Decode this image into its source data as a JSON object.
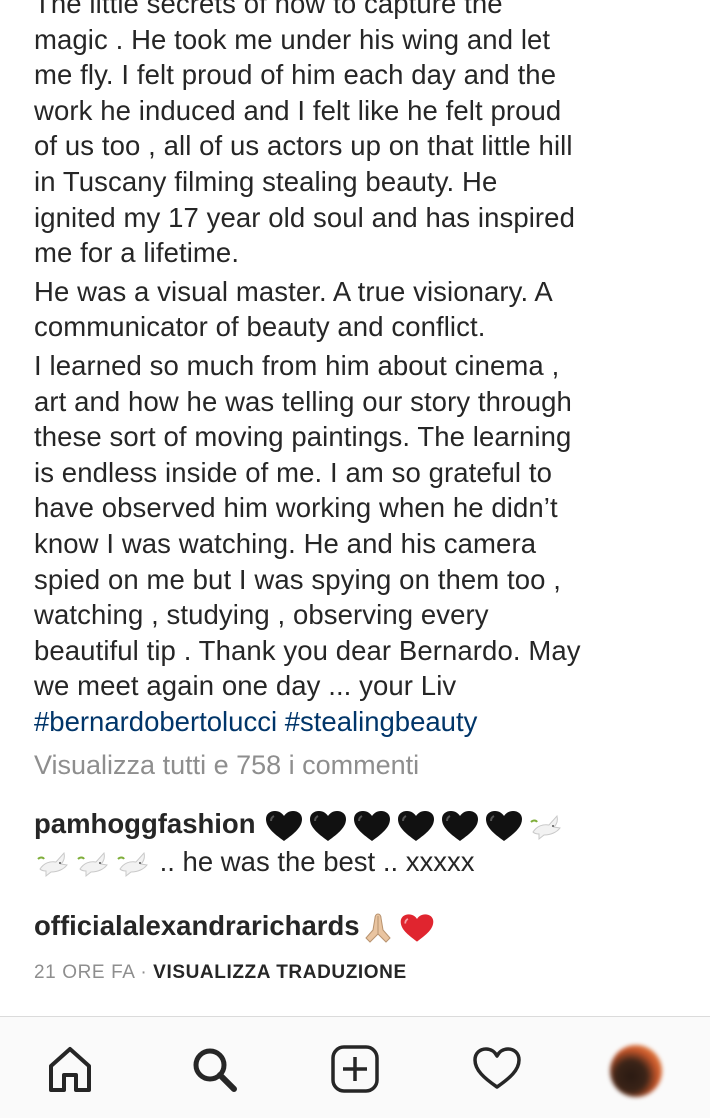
{
  "caption": {
    "lines_block1": [
      "The little secrets of how to capture the",
      "magic . He took me under his wing and let",
      "me fly. I felt proud of him each day and the",
      "work he induced and I felt like he felt proud",
      "of us too , all of us actors up on that little hill",
      "in Tuscany filming stealing beauty. He",
      "ignited my 17 year old soul and has inspired",
      "me for a lifetime."
    ],
    "lines_block2": [
      "He was a visual master. A true visionary. A",
      "communicator of beauty and conflict."
    ],
    "lines_block3": [
      "I learned so much from him about cinema ,",
      "art and how he was telling our story through",
      "these sort of moving paintings. The learning",
      "is endless inside of me. I am so grateful to",
      "have observed him working when he didn’t",
      "know I was watching. He and his camera",
      "spied on me but I was spying on them too ,",
      "watching , studying , observing every",
      "beautiful tip . Thank you dear Bernardo. May",
      "we meet again one day ... your Liv"
    ],
    "hashtags": [
      "#bernardobertolucci",
      "#stealingbeauty"
    ]
  },
  "view_comments_label": "Visualizza tutti e 758 i commenti",
  "comments": [
    {
      "username": "pamhoggfashion",
      "text": ".. he was the best .. xxxxx",
      "emojis_line1": [
        "black-heart",
        "black-heart",
        "black-heart",
        "black-heart",
        "black-heart",
        "black-heart",
        "dove"
      ],
      "emojis_line2": [
        "dove",
        "dove",
        "dove"
      ]
    },
    {
      "username": "officialalexandrarichards",
      "emojis": [
        "folded-hands",
        "red-heart"
      ]
    }
  ],
  "meta": {
    "time": "21 ORE FA",
    "separator": "·",
    "translate_label": "VISUALIZZA TRADUZIONE"
  },
  "tabbar": {
    "icons": [
      "home-icon",
      "search-icon",
      "add-post-icon",
      "activity-heart-icon",
      "profile-avatar"
    ]
  },
  "colors": {
    "text": "#262626",
    "hashtag": "#003569",
    "secondary": "#8e8e8e",
    "heart_red": "#e0252f"
  }
}
